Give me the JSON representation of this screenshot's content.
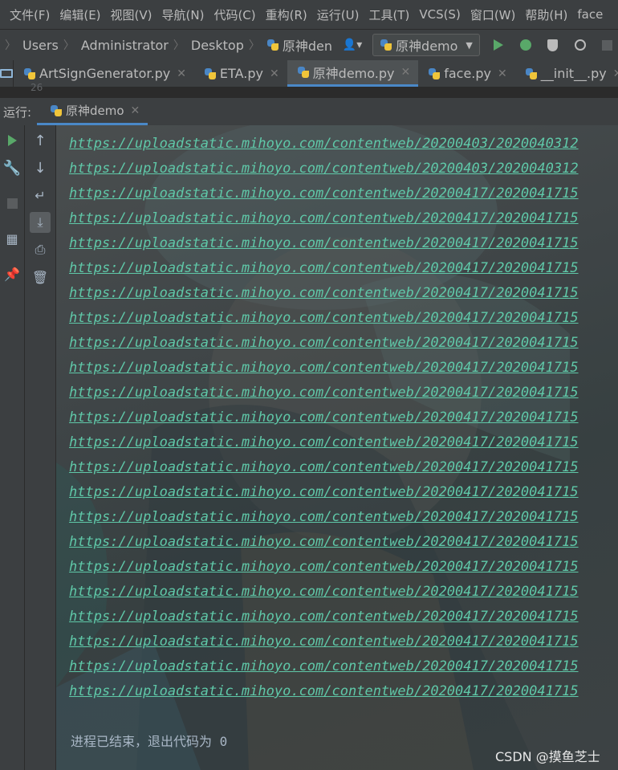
{
  "menu": [
    "文件(F)",
    "编辑(E)",
    "视图(V)",
    "导航(N)",
    "代码(C)",
    "重构(R)",
    "运行(U)",
    "工具(T)",
    "VCS(S)",
    "窗口(W)",
    "帮助(H)",
    "face"
  ],
  "breadcrumb": [
    "Users",
    "Administrator",
    "Desktop",
    "原神den"
  ],
  "run_config": "原神demo",
  "tabs": [
    {
      "label": "ArtSignGenerator.py"
    },
    {
      "label": "ETA.py"
    },
    {
      "label": "原神demo.py"
    },
    {
      "label": "face.py"
    },
    {
      "label": "__init__.py"
    }
  ],
  "editor_line": "26",
  "run_window": {
    "label": "运行:",
    "tab": "原神demo"
  },
  "console": {
    "lines": [
      "https://uploadstatic.mihoyo.com/contentweb/20200403/2020040312",
      "https://uploadstatic.mihoyo.com/contentweb/20200403/2020040312",
      "https://uploadstatic.mihoyo.com/contentweb/20200417/2020041715",
      "https://uploadstatic.mihoyo.com/contentweb/20200417/2020041715",
      "https://uploadstatic.mihoyo.com/contentweb/20200417/2020041715",
      "https://uploadstatic.mihoyo.com/contentweb/20200417/2020041715",
      "https://uploadstatic.mihoyo.com/contentweb/20200417/2020041715",
      "https://uploadstatic.mihoyo.com/contentweb/20200417/2020041715",
      "https://uploadstatic.mihoyo.com/contentweb/20200417/2020041715",
      "https://uploadstatic.mihoyo.com/contentweb/20200417/2020041715",
      "https://uploadstatic.mihoyo.com/contentweb/20200417/2020041715",
      "https://uploadstatic.mihoyo.com/contentweb/20200417/2020041715",
      "https://uploadstatic.mihoyo.com/contentweb/20200417/2020041715",
      "https://uploadstatic.mihoyo.com/contentweb/20200417/2020041715",
      "https://uploadstatic.mihoyo.com/contentweb/20200417/2020041715",
      "https://uploadstatic.mihoyo.com/contentweb/20200417/2020041715",
      "https://uploadstatic.mihoyo.com/contentweb/20200417/2020041715",
      "https://uploadstatic.mihoyo.com/contentweb/20200417/2020041715",
      "https://uploadstatic.mihoyo.com/contentweb/20200417/2020041715",
      "https://uploadstatic.mihoyo.com/contentweb/20200417/2020041715",
      "https://uploadstatic.mihoyo.com/contentweb/20200417/2020041715",
      "https://uploadstatic.mihoyo.com/contentweb/20200417/2020041715",
      "https://uploadstatic.mihoyo.com/contentweb/20200417/2020041715"
    ],
    "exit_message": "进程已结束，退出代码为 0",
    "link_color": "#5fc8a8"
  },
  "watermark": "CSDN @摸鱼芝士",
  "icons": {
    "run_toolbar": [
      "run-icon",
      "wrench-icon",
      "stop-icon",
      "layout-icon",
      "pin-icon"
    ],
    "console_toolbar": [
      "arrow-up-icon",
      "arrow-down-icon",
      "soft-wrap-icon",
      "scroll-to-end-icon",
      "print-icon",
      "trash-icon"
    ]
  }
}
